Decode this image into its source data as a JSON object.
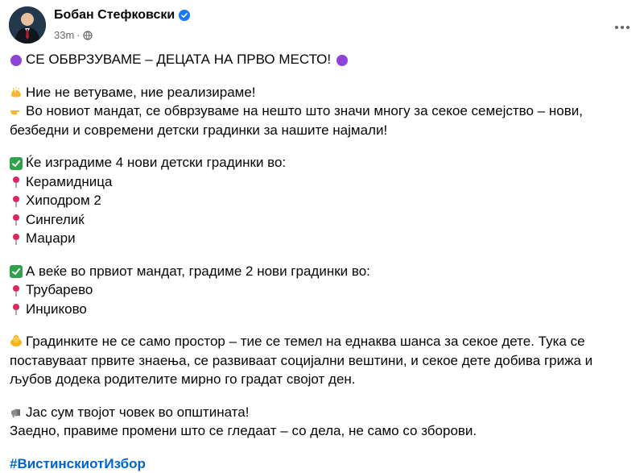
{
  "header": {
    "author": "Бобан Стефковски",
    "time": "33m",
    "privacy_icon": "globe-icon",
    "more_icon": "more-options-icon"
  },
  "post": {
    "title": "СЕ ОБВРЗУВАМЕ – ДЕЦАТА НА ПРВО МЕСТО!",
    "l1": "Ние не ветуваме, ние реализираме!",
    "l2": "Во новиот мандат, се обврзуваме на нешто што значи многу за секое семејство – нови, безбедни и современи детски градинки за нашите најмали!",
    "l3": "Ќе изградиме 4 нови детски градинки во:",
    "places_new": [
      "Керамидница",
      "Хиподром 2",
      "Сингелиќ",
      "Маџари"
    ],
    "l4": "А веќе во првиот мандат, градиме 2 нови градинки во:",
    "places_done": [
      "Трубарево",
      "Инџиково"
    ],
    "l5": "Градинките не се само простор – тие се темел на еднаква шанса за секое дете. Тука се поставуваат првите знаења, се развиваат социјални вештини, и секое дете добива грижа и љубов додека родителите мирно го градат својот ден.",
    "l6": "Јас сум твојот човек во општината!",
    "l7": "Заедно, правиме промени што се гледаат – со дела, не само со зборови.",
    "hashtag": "#ВистинскиотИзбор"
  },
  "colors": {
    "purple_circle": "#8e44d9",
    "check_green": "#31a24c",
    "pin_red": "#e0245e",
    "hashtag": "#0064d1",
    "verified": "#1877f2"
  }
}
